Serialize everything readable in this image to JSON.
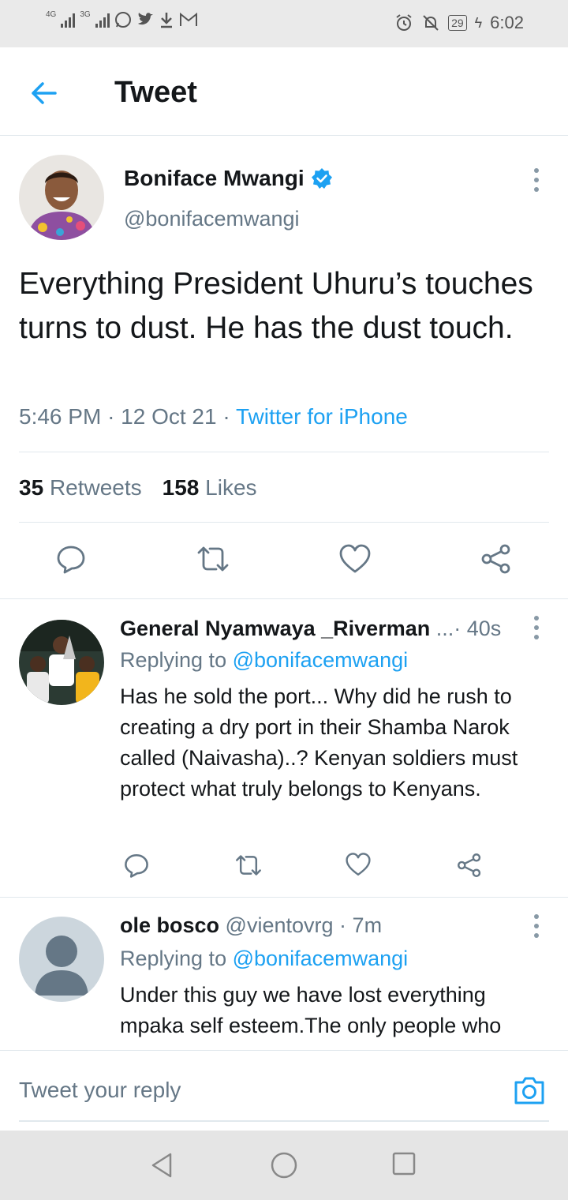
{
  "status_bar": {
    "network_1": "4G",
    "network_2": "3G",
    "battery": "29",
    "time": "6:02"
  },
  "header": {
    "title": "Tweet"
  },
  "tweet": {
    "author_name": "Boniface Mwangi",
    "author_handle": "@bonifacemwangi",
    "text": "Everything President Uhuru’s touches turns to dust. He has the dust touch.",
    "time": "5:46 PM",
    "date": "12 Oct 21",
    "source": "Twitter for iPhone",
    "retweets_count": "35",
    "retweets_label": "Retweets",
    "likes_count": "158",
    "likes_label": "Likes"
  },
  "replies": [
    {
      "name": "General Nyamwaya _Riverman",
      "ellipsis": "...",
      "time": "40s",
      "replying_prefix": "Replying to",
      "replying_to": "@bonifacemwangi",
      "text": "Has he sold the port... Why did he rush to creating a dry port in their Shamba Narok called (Naivasha)..? Kenyan soldiers must protect what truly belongs to Kenyans."
    },
    {
      "name": "ole bosco",
      "handle": "@vientovrg",
      "time": "7m",
      "replying_prefix": "Replying to",
      "replying_to": "@bonifacemwangi",
      "text": "Under this guy we have lost everything mpaka self esteem.The only people who"
    }
  ],
  "compose": {
    "placeholder": "Tweet your reply"
  },
  "icons": {
    "back": "back-arrow-icon",
    "verified": "verified-badge-icon",
    "more": "more-vertical-icon",
    "reply": "reply-icon",
    "retweet": "retweet-icon",
    "like": "heart-icon",
    "share": "share-icon",
    "camera": "camera-icon"
  },
  "colors": {
    "accent": "#1da1f2",
    "muted": "#657786",
    "text": "#14171a"
  }
}
